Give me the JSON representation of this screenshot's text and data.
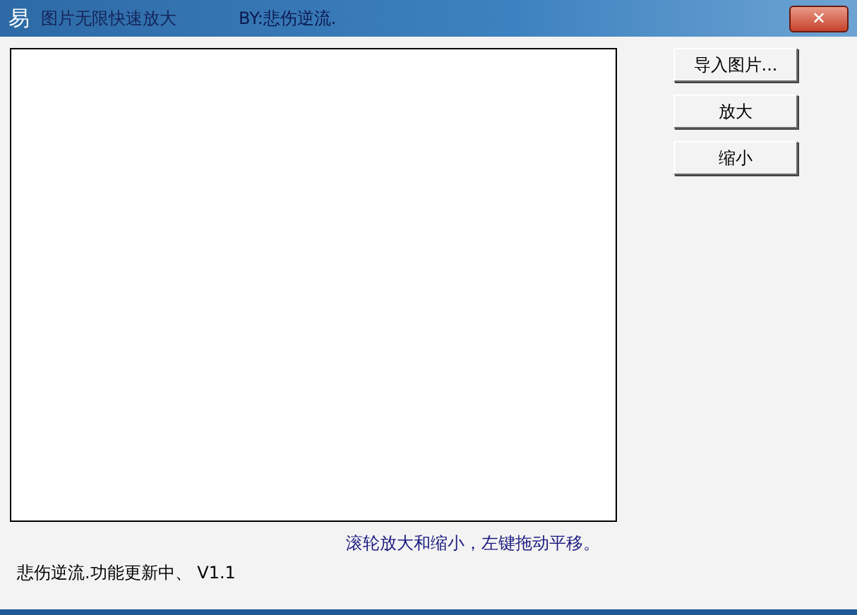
{
  "window": {
    "app_icon": "易",
    "title": "图片无限快速放大",
    "author": "BY:悲伤逆流.",
    "close": "✕"
  },
  "buttons": [
    {
      "label": "导入图片..."
    },
    {
      "label": "放大"
    },
    {
      "label": "缩小"
    }
  ],
  "hint": "滚轮放大和缩小，左键拖动平移。",
  "status": "悲伤逆流.功能更新中、 V1.1"
}
